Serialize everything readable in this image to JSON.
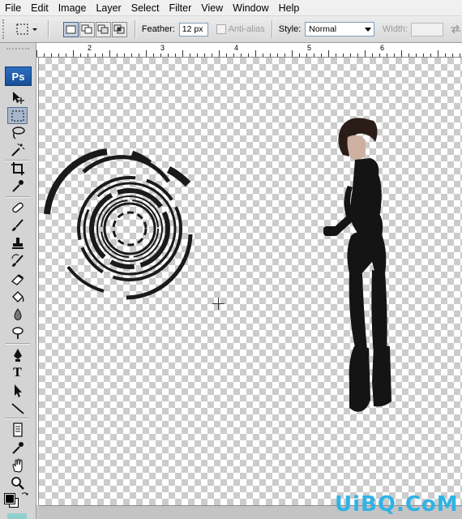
{
  "menu": [
    "File",
    "Edit",
    "Image",
    "Layer",
    "Select",
    "Filter",
    "View",
    "Window",
    "Help"
  ],
  "options": {
    "feather_label": "Feather:",
    "feather_value": "12 px",
    "antialias_label": "Anti-alias",
    "style_label": "Style:",
    "style_value": "Normal",
    "width_label": "Width:"
  },
  "toolbox": {
    "logo": "Ps",
    "type_tool_glyph": "T",
    "tools": [
      "move-icon",
      "rectangular-marquee-icon",
      "lasso-icon",
      "magic-wand-icon",
      "crop-icon",
      "eyedropper-icon",
      "healing-brush-icon",
      "brush-icon",
      "clone-stamp-icon",
      "history-brush-icon",
      "eraser-icon",
      "paint-bucket-icon",
      "blur-icon",
      "dodge-icon",
      "pen-icon",
      "type-icon",
      "path-selection-icon",
      "line-icon",
      "notes-icon",
      "eyedropper-icon",
      "hand-icon",
      "zoom-icon"
    ]
  },
  "ruler": {
    "labels": [
      "2",
      "3",
      "4",
      "5",
      "6"
    ]
  },
  "watermark": "UiBQ.CoM",
  "colors": {
    "foreground": "#000000",
    "background": "#ffffff",
    "logo_blue": "#1f5aa8",
    "watermark": "#2fb3e6"
  }
}
